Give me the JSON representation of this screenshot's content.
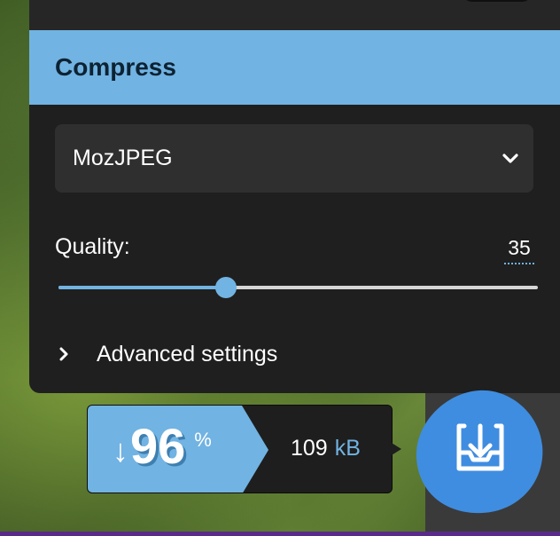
{
  "section": {
    "title": "Compress"
  },
  "encoder": {
    "selected": "MozJPEG"
  },
  "quality": {
    "label": "Quality:",
    "value": "35",
    "fraction": 0.35
  },
  "advanced": {
    "label": "Advanced settings"
  },
  "result": {
    "arrow": "↓",
    "percent": "96",
    "percent_sign": "%",
    "size_value": "109",
    "size_unit": "kB"
  },
  "icons": {
    "select": "chevron-down-icon",
    "advanced": "chevron-right-icon",
    "download": "download-icon"
  },
  "colors": {
    "accent": "#71b3e2",
    "panel": "#1f1f1f",
    "title_text": "#0d2233",
    "download_blob": "#3f8de0"
  }
}
